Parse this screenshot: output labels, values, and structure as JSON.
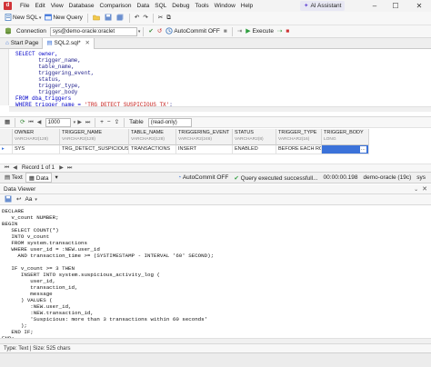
{
  "menu": [
    "File",
    "Edit",
    "View",
    "Database",
    "Comparison",
    "Data",
    "SQL",
    "Debug",
    "Tools",
    "Window",
    "Help"
  ],
  "ai_assistant": "AI Assistant",
  "toolbar": {
    "new_sql": "New SQL",
    "new_query": "New Query",
    "connection_label": "Connection",
    "connection_value": "sys@demo-oracle:oraclet",
    "autocommit": "AutoCommit OFF",
    "execute": "Execute"
  },
  "tabs": {
    "start_page": "Start Page",
    "sql_tab": "SQL2.sql*"
  },
  "editor": {
    "lines": [
      "SELECT owner,",
      "       trigger_name,",
      "       table_name,",
      "       triggering_event,",
      "       status,",
      "       trigger_type,",
      "       trigger_body",
      "FROM dba_triggers",
      "WHERE trigger_name = 'TRG_DETECT_SUSPICIOUS_TX';"
    ]
  },
  "grid_toolbar": {
    "row_limit": "1000",
    "table_label": "Table",
    "readonly": "(read-only)"
  },
  "grid": {
    "columns": [
      {
        "name": "OWNER",
        "type": "VARCHAR2(128)"
      },
      {
        "name": "TRIGGER_NAME",
        "type": "VARCHAR2(128)"
      },
      {
        "name": "TABLE_NAME",
        "type": "VARCHAR2(128)"
      },
      {
        "name": "TRIGGERING_EVENT",
        "type": "VARCHAR2(246)"
      },
      {
        "name": "STATUS",
        "type": "VARCHAR2(8)"
      },
      {
        "name": "TRIGGER_TYPE",
        "type": "VARCHAR2(16)"
      },
      {
        "name": "TRIGGER_BODY",
        "type": "LONG"
      }
    ],
    "row": [
      "SYS",
      "TRG_DETECT_SUSPICIOUS_TX",
      "TRANSACTIONS",
      "INSERT",
      "ENABLED",
      "BEFORE EACH ROW",
      ""
    ]
  },
  "record_bar": {
    "record": "Record 1 of 1"
  },
  "status_bar": {
    "text_tab": "Text",
    "data_tab": "Data",
    "autocommit": "AutoCommit OFF",
    "message": "Query executed successfull...",
    "elapsed": "00:00:00.198",
    "connection": "demo-oracle (19c)",
    "user": "sys"
  },
  "data_viewer": {
    "title": "Data Viewer",
    "lines": [
      "DECLARE",
      "   v_count NUMBER;",
      "BEGIN",
      "   SELECT COUNT(*)",
      "   INTO v_count",
      "   FROM system.transactions",
      "   WHERE user_id = :NEW.user_id",
      "     AND transaction_time >= (SYSTIMESTAMP - INTERVAL '60' SECOND);",
      "",
      "   IF v_count >= 3 THEN",
      "      INSERT INTO system.suspicious_activity_log (",
      "         user_id,",
      "         transaction_id,",
      "         message",
      "      ) VALUES (",
      "         :NEW.user_id,",
      "         :NEW.transaction_id,",
      "         'Suspicious: more than 3 transactions within 60 seconds'",
      "      );",
      "   END IF;",
      "END;"
    ],
    "status": "Type: Text | Size: 525 chars"
  }
}
